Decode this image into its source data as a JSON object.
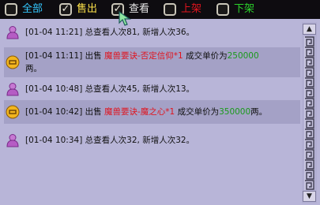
{
  "filters": [
    {
      "label": "全部",
      "checked": false,
      "color": "#34c8ff"
    },
    {
      "label": "售出",
      "checked": true,
      "color": "#ffe44a"
    },
    {
      "label": "查看",
      "checked": true,
      "color": "#e6e6e6"
    },
    {
      "label": "上架",
      "checked": false,
      "color": "#e0141e"
    },
    {
      "label": "下架",
      "checked": false,
      "color": "#2bd22b"
    }
  ],
  "messages": [
    {
      "type": "view",
      "time": "[01-04 11:21]",
      "text": "总查看人次81, 新增人次36。"
    },
    {
      "type": "sale",
      "time": "[01-04 11:11]",
      "verb": "出售",
      "item": "魔兽要诀-否定信仰*1",
      "price_label": "成交单价为",
      "price": "250000",
      "unit": "两。"
    },
    {
      "type": "view",
      "time": "[01-04 10:48]",
      "text": "总查看人次45, 新增人次13。"
    },
    {
      "type": "sale",
      "time": "[01-04 10:42]",
      "verb": "出售",
      "item": "魔兽要诀-魔之心*1",
      "price_label": "成交单价为",
      "price": "350000",
      "unit": "两。"
    },
    {
      "type": "view",
      "time": "[01-04 10:34]",
      "text": "总查看人次32, 新增人次32。"
    }
  ],
  "icons": {
    "view": "person-icon",
    "sale": "coin-icon"
  },
  "colors": {
    "item": "#e0141e",
    "price": "#1a9a1a",
    "alt_row": "#a4a1c6"
  }
}
